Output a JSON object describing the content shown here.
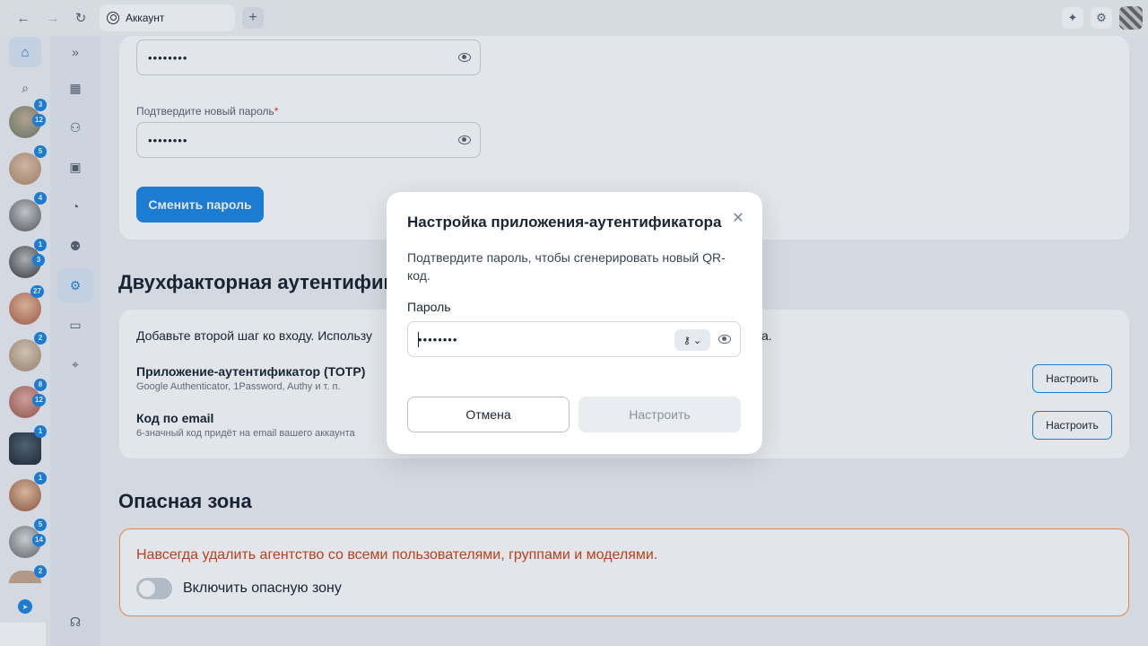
{
  "browser": {
    "tab_label": "Аккаунт",
    "new_tab_symbol": "+",
    "icons": [
      "back-icon",
      "forward-icon",
      "reload-icon",
      "sparkle-icon",
      "settings-icon"
    ]
  },
  "rail": {
    "chats": [
      {
        "badges": [
          "3",
          "12"
        ]
      },
      {
        "badges": [
          "5"
        ]
      },
      {
        "badges": [
          "4"
        ]
      },
      {
        "badges": [
          "1",
          "3"
        ]
      },
      {
        "badges": [
          "27"
        ]
      },
      {
        "badges": [
          "2"
        ]
      },
      {
        "badges": [
          "8",
          "12"
        ]
      },
      {
        "badges": [
          "1"
        ]
      },
      {
        "badges": [
          "1"
        ]
      },
      {
        "badges": [
          "5",
          "14"
        ]
      },
      {
        "badges": [
          "2"
        ]
      }
    ]
  },
  "password_section": {
    "new_password_value": "••••••••",
    "confirm_label": "Подтвердите новый пароль",
    "confirm_value": "••••••••",
    "change_button": "Сменить пароль"
  },
  "two_factor": {
    "heading": "Двухфакторная аутентифик",
    "intro_left": "Добавьте второй шаг ко входу. Использу",
    "intro_right": "а.",
    "totp_title": "Приложение-аутентификатор (TOTP)",
    "totp_sub": "Google Authenticator, 1Password, Authy и т. п.",
    "email_title": "Код по email",
    "email_sub": "6-значный код придёт на email вашего аккаунта",
    "setup_label": "Настроить"
  },
  "danger": {
    "heading": "Опасная зона",
    "warning": "Навсегда удалить агентство со всеми пользователями, группами и моделями.",
    "toggle_label": "Включить опасную зону"
  },
  "modal": {
    "title": "Настройка приложения-аутентификатора",
    "description": "Подтвердите пароль, чтобы сгенерировать новый QR-код.",
    "field_label": "Пароль",
    "field_value": "••••••••",
    "cancel": "Отмена",
    "submit": "Настроить"
  }
}
